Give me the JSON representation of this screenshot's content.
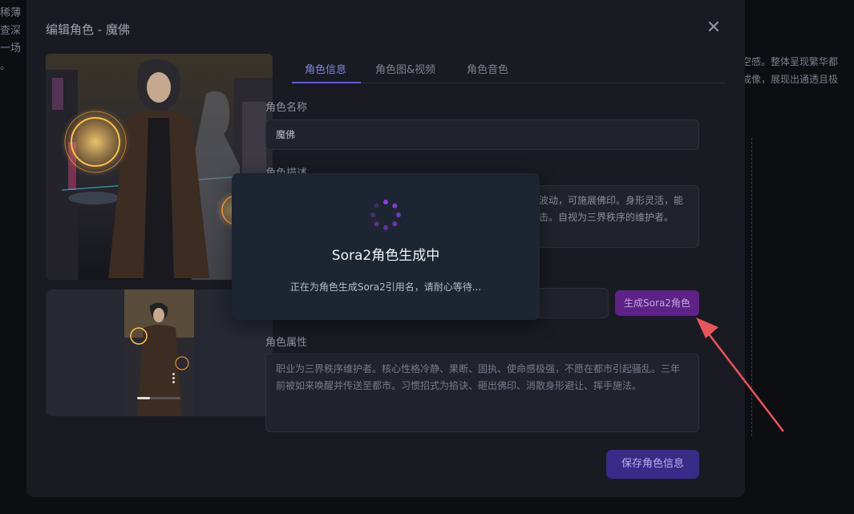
{
  "background": {
    "left_lines": [
      "稀薄",
      "查深",
      "一场",
      "。"
    ],
    "right_lines": [
      "空感。整体呈现繁华都",
      "成像，展现出通透且极"
    ]
  },
  "modal": {
    "title": "编辑角色 - 魔佛",
    "close": "✕"
  },
  "tabs": [
    {
      "label": "角色信息",
      "active": true
    },
    {
      "label": "角色图&视频",
      "active": false
    },
    {
      "label": "角色音色",
      "active": false
    }
  ],
  "form": {
    "name_label": "角色名称",
    "name_value": "魔佛",
    "desc_label": "角色描述",
    "desc_visible_lines": [
      "波动，可施展佛印。身形灵活，能",
      "击。自视为三界秩序的维护者。"
    ],
    "sora_button": "生成Sora2角色",
    "attr_label": "角色属性",
    "attr_value": "职业为三界秩序维护者。核心性格冷静、果断、固执、使命感极强，不愿在都市引起骚乱。三年前被如来唤醒并传送至都市。习惯招式为掐诀、砸出佛印、消散身形避让、挥手施法。",
    "save_button": "保存角色信息"
  },
  "video": {
    "progress": 0.3
  },
  "loading": {
    "title": "Sora2角色生成中",
    "subtitle": "正在为角色生成Sora2引用名，请耐心等待..."
  },
  "colors": {
    "accent": "#5b63c9",
    "sora_button": "#5c2286",
    "save_button": "#3a2a8a",
    "spinner": "#8b3fe0",
    "arrow": "#e8555a"
  }
}
